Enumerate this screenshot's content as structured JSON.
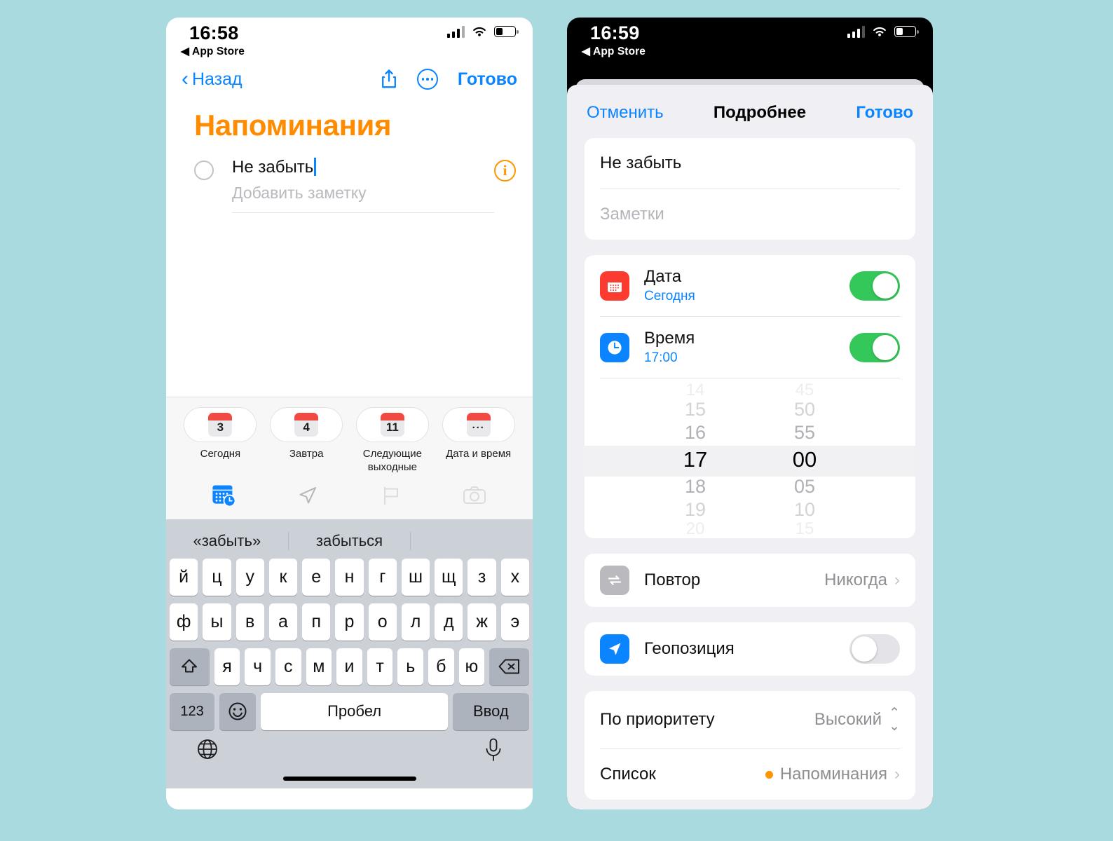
{
  "left_phone": {
    "status": {
      "time": "16:58",
      "back_app": "App Store"
    },
    "nav": {
      "back": "Назад",
      "done": "Готово"
    },
    "list_title": "Напоминания",
    "reminder": {
      "title": "Не забыть",
      "note_placeholder": "Добавить заметку"
    },
    "suggestions": [
      {
        "icon": "3",
        "label": "Сегодня"
      },
      {
        "icon": "4",
        "label": "Завтра"
      },
      {
        "icon": "11",
        "label": "Следующие выходные"
      },
      {
        "icon": "···",
        "label": "Дата и время"
      }
    ],
    "keyboard": {
      "predictions": [
        "«забыть»",
        "забыться"
      ],
      "row1": [
        "й",
        "ц",
        "у",
        "к",
        "е",
        "н",
        "г",
        "ш",
        "щ",
        "з",
        "х"
      ],
      "row2": [
        "ф",
        "ы",
        "в",
        "а",
        "п",
        "р",
        "о",
        "л",
        "д",
        "ж",
        "э"
      ],
      "row3": [
        "я",
        "ч",
        "с",
        "м",
        "и",
        "т",
        "ь",
        "б",
        "ю"
      ],
      "numbers_key": "123",
      "space_key": "Пробел",
      "enter_key": "Ввод"
    }
  },
  "right_phone": {
    "status": {
      "time": "16:59",
      "back_app": "App Store"
    },
    "nav": {
      "cancel": "Отменить",
      "title": "Подробнее",
      "done": "Готово"
    },
    "fields": {
      "title_value": "Не забыть",
      "notes_placeholder": "Заметки"
    },
    "date_row": {
      "label": "Дата",
      "value": "Сегодня",
      "toggle": "on"
    },
    "time_row": {
      "label": "Время",
      "value": "17:00",
      "toggle": "on"
    },
    "picker": {
      "hours": [
        "14",
        "15",
        "16",
        "17",
        "18",
        "19",
        "20"
      ],
      "minutes": [
        "45",
        "50",
        "55",
        "00",
        "05",
        "10",
        "15"
      ],
      "selected_hour": "17",
      "selected_minute": "00"
    },
    "repeat_row": {
      "label": "Повтор",
      "value": "Никогда"
    },
    "location_row": {
      "label": "Геопозиция",
      "toggle": "off"
    },
    "priority_row": {
      "label": "По приоритету",
      "value": "Высокий"
    },
    "list_row": {
      "label": "Список",
      "value": "Напоминания"
    }
  },
  "colors": {
    "background": "#a8dadf",
    "accent_blue": "#0a84ff",
    "accent_orange": "#ff8c00",
    "toggle_green": "#34c759",
    "calendar_red": "#fc3b30"
  }
}
